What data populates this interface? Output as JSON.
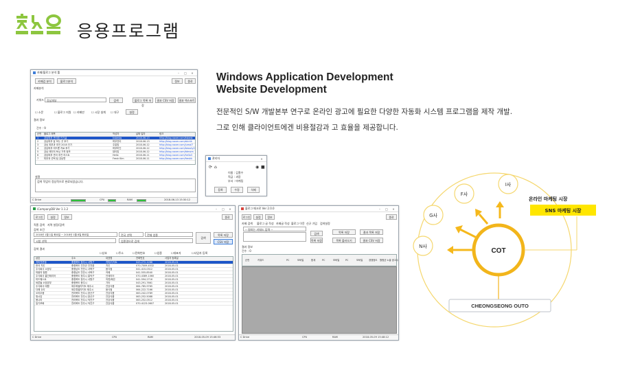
{
  "header": {
    "logo_text": "참소오",
    "page_title": "응용프로그램"
  },
  "heading": {
    "line1": "Windows Application Development",
    "line2": "Website Development"
  },
  "description": {
    "line1": "전문적인 S/W 개발본부 연구로 온라인 광고에 필요한 다양한 자동화 시스템 프로그램을 제작 개발.",
    "line2": "그로 인해 클라이언트에겐 비용절감과 고 효율을 제공합니다."
  },
  "window1": {
    "title": "카페/블로그 분석 툴",
    "tabs": [
      "카페검 분석",
      "블로그분석"
    ],
    "top_buttons": [
      "정보",
      "종료"
    ],
    "section_label": "카페분석",
    "keyword_label": "키워드",
    "keyword_value": "강남피부",
    "search_button": "검색",
    "right_buttons": [
      "블로그 목록 저장",
      "결과 CSV 저장",
      "결과 엑스포트"
    ],
    "options": [
      "소문",
      "블로그 지원",
      "카페만",
      "시장 설계",
      "대구"
    ],
    "options_button": "설정",
    "result_label": "결과 정보",
    "count_text": "건수 : 9",
    "columns": [
      "순번",
      "블로그 제목",
      "작성자",
      "날짜 일자",
      "링크"
    ],
    "rows": [
      {
        "n": "1",
        "title": "강남피부 관리법 인기글",
        "author": "ksbestq",
        "date": "2018-06-13",
        "link": "http://blog.naver.com/ksbest"
      },
      {
        "n": "2",
        "title": "강남피부 잘 보는 곳 후기",
        "author": "피부관리",
        "date": "2018-06-13",
        "link": "http://blog.naver.com/skinth"
      },
      {
        "n": "3",
        "title": "강남 피부과 추천 2018 인기",
        "author": "주말맘",
        "date": "2018-06-12",
        "link": "http://blog.naver.com/jumal7"
      },
      {
        "n": "4",
        "title": "강남피부 여드름 치료 후기",
        "author": "피부미인",
        "date": "2018-06-12",
        "link": "http://blog.naver.com/beauty0"
      },
      {
        "n": "5",
        "title": "강남 레이저 토닝 가격 정보",
        "author": "뷰티맘",
        "date": "2018-06-12",
        "link": "http://blog.naver.com/btmom"
      },
      {
        "n": "6",
        "title": "강남피부 관리 추천 리스트",
        "author": "Hello",
        "date": "2018-06-11",
        "link": "http://blog.naver.com/hello3"
      },
      {
        "n": "7",
        "title": "피부과 선택 팁 강남편",
        "author": "Fresh Kim",
        "date": "2018-06-11",
        "link": "http://blog.naver.com/freshk"
      }
    ],
    "log_label": "설명",
    "log_text": "검색 작업이 정상적으로 완료되었습니다.",
    "status": {
      "cpu": "CPU",
      "mem": "RAM",
      "time": "2018-06-13 15:30:12"
    }
  },
  "window2": {
    "title": "관리자",
    "label1": "이름 : 김철수",
    "label2": "직급 : 과장",
    "label3": "부서 : 마케팅",
    "buttons": [
      "등록",
      "수정",
      "삭제"
    ]
  },
  "window3": {
    "title": "iCompanyDB Ver 1.1.2",
    "tabs": [
      "로그인",
      "설정",
      "정보"
    ],
    "top_right": "종료",
    "search_labels": [
      "직종 검색",
      "지역 설정/검색"
    ],
    "search_title": "검색 조건",
    "date_text": "2018년 1월 1일 화요일  ~  2018년 1월 8일 화요일",
    "combo1": "전국 선택",
    "combo2": "전체 업종",
    "combo3": "시청 선택",
    "combo4": "업종명으로 검색",
    "search_button": "검색",
    "right_buttons": [
      "목록 저장",
      "CSV 저장"
    ],
    "result_label": "검색 결과",
    "filters": [
      "상호",
      "주소",
      "전화번호",
      "업종",
      "대표자",
      "사업자 등록"
    ],
    "columns": [
      "상호",
      "주소",
      "대표명",
      "전화번호",
      "사업자 등록일"
    ],
    "rows": [
      {
        "a": "커피전문점",
        "b": "충청북도 청주시 서원구",
        "c": "커피/디저트",
        "d": "043-272-1288",
        "e": "2018-05-01"
      },
      {
        "a": "한국 치킨",
        "b": "충청북도 진천군 진천읍",
        "c": "치킨",
        "d": "070-7009-4532",
        "e": "2018-05-01"
      },
      {
        "a": "주식회사 소망무",
        "b": "충청남도 천안시 서북구",
        "c": "음식점",
        "d": "041-415-0312",
        "e": "2018-05-01"
      },
      {
        "a": "마음의 정원",
        "b": "충청남도 천안시 서북구",
        "c": "카페",
        "d": "041-555-8540",
        "e": "2018-05-01"
      },
      {
        "a": "주식회사 홈인테리어",
        "b": "충청북도 청주시 흥덕구",
        "c": "인테리어",
        "d": "070-4389-1060",
        "e": "2018-05-01"
      },
      {
        "a": "미드웨스트",
        "b": "충청북도 청주시 서원구",
        "c": "의류/패션",
        "d": "041-594-2716",
        "e": "2018-05-01"
      },
      {
        "a": "바른들 소방본부",
        "b": "충청북도 충주시",
        "c": "기타",
        "d": "043-291-7661",
        "e": "2018-05-01"
      },
      {
        "a": "주식회사 태평",
        "b": "제주특별자치도 제주시",
        "c": "건강식품",
        "d": "064-785-9765",
        "e": "2018-05-01"
      },
      {
        "a": "다해 두리",
        "b": "제주특별자치도 제주시",
        "c": "음식점",
        "d": "064-222-7166",
        "e": "2018-05-01"
      },
      {
        "a": "오리무중",
        "b": "전라북도 전주시 완산구",
        "c": "건강식품",
        "d": "063-242-0789",
        "e": "2018-05-01"
      },
      {
        "a": "청시담",
        "b": "전라북도 전주시 완산구",
        "c": "건강식품",
        "d": "063-252-5088",
        "e": "2018-05-01"
      },
      {
        "a": "봄나라",
        "b": "전라북도 전주시 덕진구",
        "c": "건강식품",
        "d": "063-252-0512",
        "e": "2018-05-01"
      },
      {
        "a": "일기포화",
        "b": "전라북도 전주시 덕진구",
        "c": "건강식품",
        "d": "070-4123-0607",
        "e": "2018-05-01"
      }
    ],
    "status": {
      "disk": "C Drive",
      "cpu": "CPU",
      "ram": "RAM",
      "time": "2018-05-09 15:46:53"
    }
  },
  "window4": {
    "title": "블로그 매크로 Ver 2.0.0",
    "tabs": [
      "로그인",
      "설정",
      "정보"
    ],
    "top_right": "종료",
    "subtabs": [
      "카페 검색",
      "블로그 글 작성",
      "카페글 작성",
      "블로그 이웃",
      "신규 가입",
      "검색설정"
    ],
    "combo_text": "-- 원하는 키워드 입력 --",
    "small_buttons": [
      "검색",
      "목록 저장"
    ],
    "right_buttons": [
      "목록 저장",
      "결과 목록 저장",
      "목록 불러오기",
      "결과 CSV 저장"
    ],
    "result_label": "결과 정보",
    "count": "건수 : 0",
    "columns": [
      "순번",
      "키워드",
      "PC",
      "모바일",
      "합계",
      "PC",
      "모바일",
      "PC",
      "모바일",
      "경쟁정도",
      "월평균 노출 광고수"
    ],
    "status": {
      "disk": "C Drive",
      "cpu": "CPU",
      "ram": "RAM",
      "time": "2018-05-09 15:48:12"
    }
  },
  "diagram": {
    "center": "COT",
    "nodes": [
      "I사",
      "F사",
      "G사",
      "N사"
    ],
    "bottom_label": "CHEONGSEONG OUTO",
    "market_title": "온라인 마케팅 시장",
    "market_box": "SNS 마케팅 시장"
  },
  "colors": {
    "accent_green": "#8dc63f",
    "badge_yellow": "#ffe600",
    "circle": "#f5d76e",
    "arrow": "#f5b81c",
    "selection": "#1e56c8"
  }
}
